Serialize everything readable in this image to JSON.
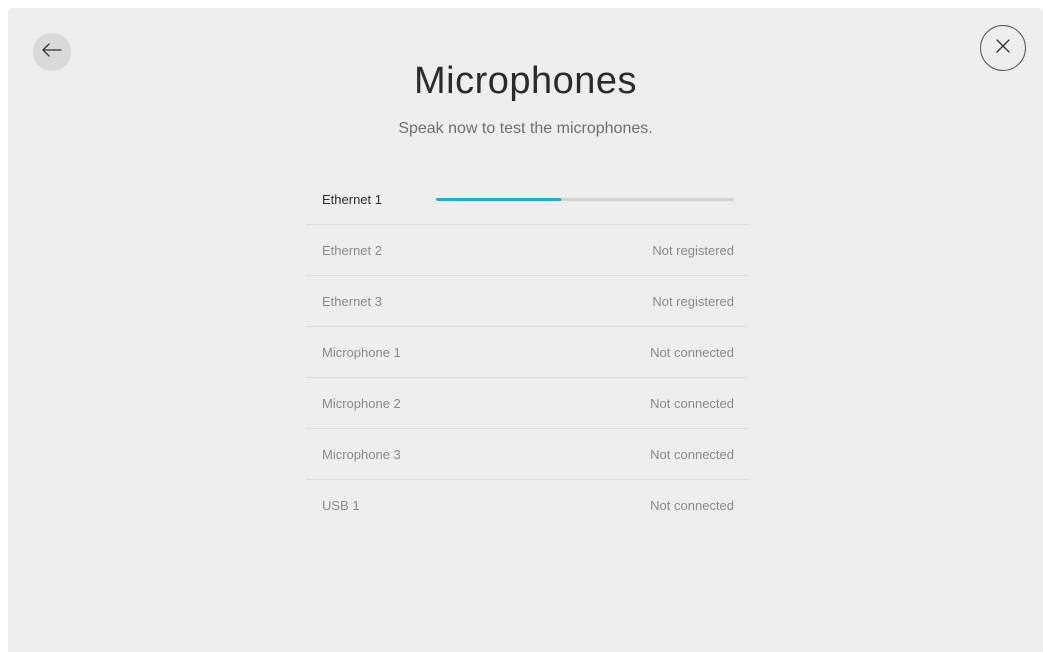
{
  "header": {
    "title": "Microphones",
    "subtitle": "Speak now to test the microphones."
  },
  "icons": {
    "back": "arrow-left-icon",
    "close": "close-icon"
  },
  "colors": {
    "accent": "#26a9d8",
    "background": "#eeeeee"
  },
  "microphones": [
    {
      "name": "Ethernet 1",
      "status": "",
      "level": 0.42,
      "active": true
    },
    {
      "name": "Ethernet 2",
      "status": "Not registered"
    },
    {
      "name": "Ethernet 3",
      "status": "Not registered"
    },
    {
      "name": "Microphone 1",
      "status": "Not connected"
    },
    {
      "name": "Microphone 2",
      "status": "Not connected"
    },
    {
      "name": "Microphone 3",
      "status": "Not connected"
    },
    {
      "name": "USB 1",
      "status": "Not connected"
    }
  ]
}
